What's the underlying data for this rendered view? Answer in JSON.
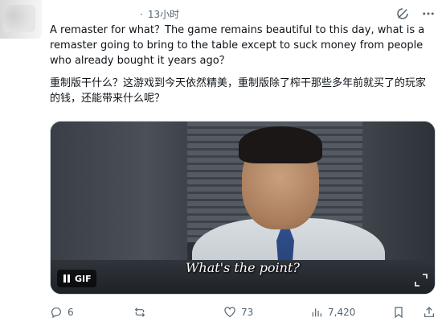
{
  "header": {
    "timestamp": "13小时",
    "icons": [
      "grok-icon",
      "more-icon"
    ]
  },
  "tweet": {
    "text_en": "A remaster for what？The game remains beautiful to this day, what is a remaster going to bring to the table except to suck money from people who already bought it years ago？",
    "text_zh": "重制版干什么？这游戏到今天依然精美，重制版除了榨干那些多年前就买了的玩家的钱，还能带来什么呢？"
  },
  "media": {
    "caption": "What's the point?",
    "gif_label": "GIF"
  },
  "actions": {
    "reply_count": "6",
    "retweet_count": "",
    "like_count": "73",
    "views_count": "7,420"
  },
  "colors": {
    "text": "#0f1419",
    "secondary": "#536471",
    "border": "#cfd9de"
  }
}
